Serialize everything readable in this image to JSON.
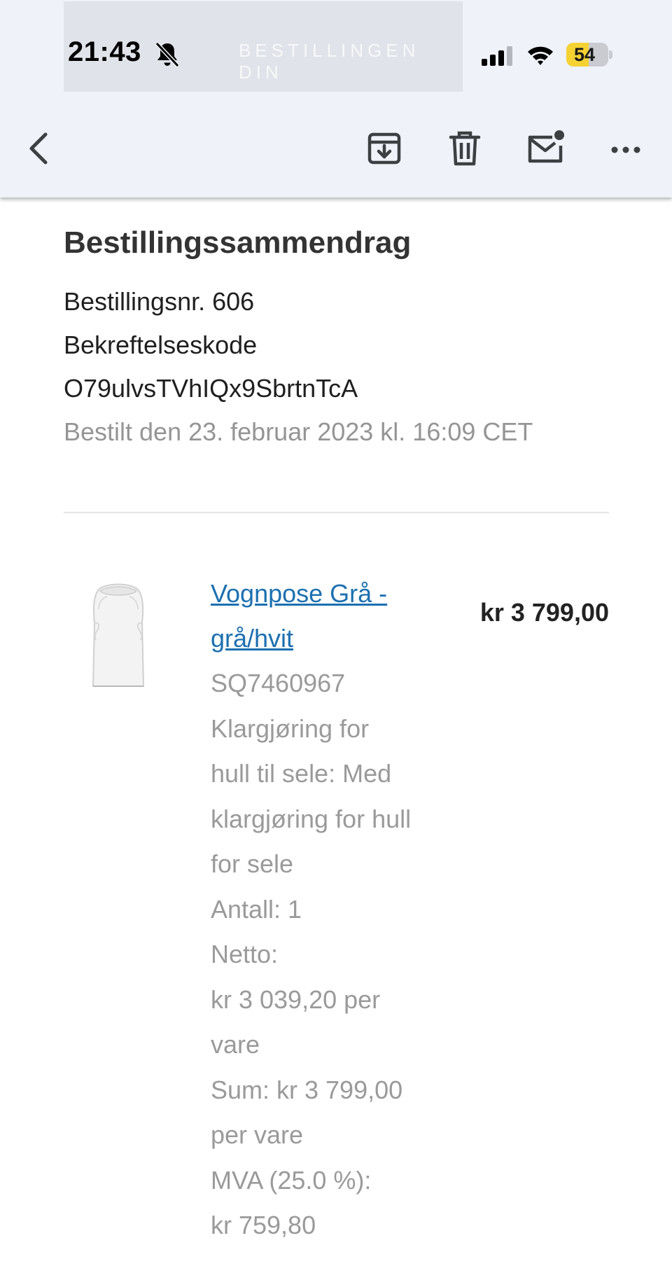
{
  "status_bar": {
    "time": "21:43",
    "battery_level": "54",
    "battery_percent": 54,
    "banner_text": "BESTILLINGEN DIN"
  },
  "toolbar": {
    "back_icon": "chevron-left-icon",
    "archive_icon": "archive-icon",
    "delete_icon": "trash-icon",
    "unread_icon": "mark-unread-icon",
    "more_icon": "more-horizontal-icon"
  },
  "order": {
    "title": "Bestillingssammendrag",
    "number": "Bestillingsnr. 606",
    "confirmation_label": "Bekreftelseskode",
    "confirmation_code": "O79ulvsTVhIQx9SbrtnTcA",
    "date": "Bestilt den 23. februar 2023 kl. 16:09 CET"
  },
  "item": {
    "name_lines": [
      "Vognpose Grå -",
      "grå/hvit"
    ],
    "price": "kr 3 799,00",
    "details": [
      "SQ7460967",
      "Klargjøring for",
      "hull til sele: Med",
      "klargjøring for hull",
      "for sele",
      "Antall: 1",
      "Netto:",
      "kr 3 039,20 per",
      "vare",
      "Sum: kr 3 799,00",
      "per vare",
      "MVA (25.0 %):",
      "kr 759,80"
    ]
  },
  "colors": {
    "link": "#1c70b0",
    "battery": "#f5d232",
    "chrome_background": "#eff2f8",
    "muted_text": "#9a9a9a"
  }
}
